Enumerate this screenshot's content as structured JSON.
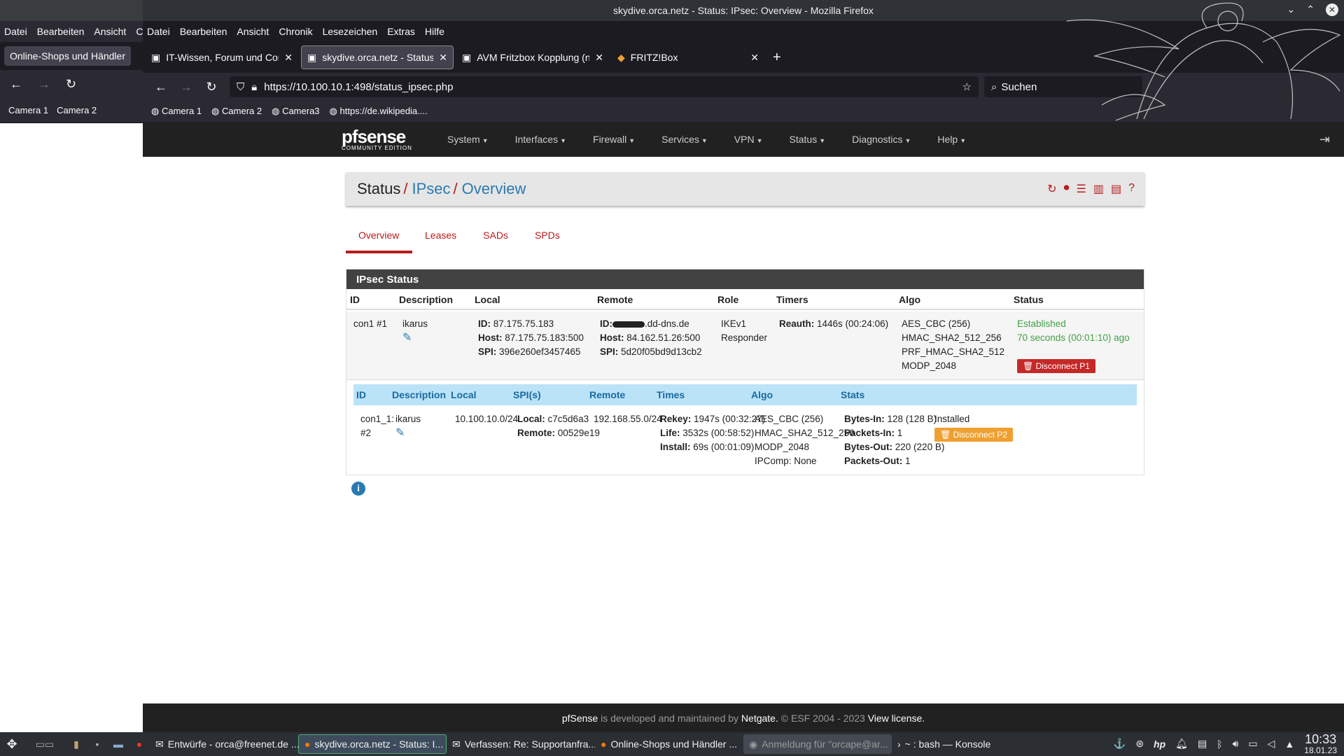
{
  "window_title": "skydive.orca.netz - Status: IPsec: Overview - Mozilla Firefox",
  "menu": [
    "Datei",
    "Bearbeiten",
    "Ansicht",
    "Chronik",
    "Lesezeichen",
    "Extras",
    "Hilfe"
  ],
  "tabs": [
    {
      "label": "IT-Wissen, Forum und Com",
      "active": false
    },
    {
      "label": "skydive.orca.netz - Status:",
      "active": true
    },
    {
      "label": "AVM Fritzbox Kopplung (ne",
      "active": false
    },
    {
      "label": "FRITZ!Box",
      "active": false
    }
  ],
  "new_tab": "+",
  "url": "https://10.100.10.1:498/status_ipsec.php",
  "search_placeholder": "Suchen",
  "bookmarks": [
    "Camera 1",
    "Camera 2",
    "Camera3",
    "https://de.wikipedia...."
  ],
  "bg_window": {
    "menu": [
      "Datei",
      "Bearbeiten",
      "Ansicht",
      "C"
    ],
    "tab": "Online-Shops und Händler",
    "bookmarks": [
      "Camera 1",
      "Camera 2"
    ]
  },
  "pfsense": {
    "logo": "pfsense",
    "logo_sub": "COMMUNITY EDITION",
    "menu": [
      "System",
      "Interfaces",
      "Firewall",
      "Services",
      "VPN",
      "Status",
      "Diagnostics",
      "Help"
    ],
    "breadcrumb": {
      "root": "Status",
      "section": "IPsec",
      "page": "Overview"
    },
    "subtabs": [
      "Overview",
      "Leases",
      "SADs",
      "SPDs"
    ],
    "panel_title": "IPsec Status",
    "p1_headers": [
      "ID",
      "Description",
      "Local",
      "Remote",
      "Role",
      "Timers",
      "Algo",
      "Status"
    ],
    "p1": {
      "id": "con1 #1",
      "description": "ikarus",
      "local_id_label": "ID:",
      "local_id": "87.175.75.183",
      "local_host_label": "Host:",
      "local_host": "87.175.75.183:500",
      "local_spi_label": "SPI:",
      "local_spi": "396e260ef3457465",
      "remote_id_label": "ID:",
      "remote_id": ".dd-dns.de",
      "remote_host_label": "Host:",
      "remote_host": "84.162.51.26:500",
      "remote_spi_label": "SPI:",
      "remote_spi": "5d20f05bd9d13cb2",
      "role1": "IKEv1",
      "role2": "Responder",
      "timer_label": "Reauth:",
      "timer": "1446s (00:24:06)",
      "algo": [
        "AES_CBC (256)",
        "HMAC_SHA2_512_256",
        "PRF_HMAC_SHA2_512",
        "MODP_2048"
      ],
      "status": "Established",
      "status_time": "70 seconds (00:01:10) ago",
      "disconnect": "Disconnect P1"
    },
    "p2_headers": [
      "ID",
      "Description",
      "Local",
      "SPI(s)",
      "Remote",
      "Times",
      "Algo",
      "Stats"
    ],
    "p2": {
      "id1": "con1_1:",
      "id2": "#2",
      "description": "ikarus",
      "local": "10.100.10.0/24",
      "spi_local_label": "Local:",
      "spi_local": "c7c5d6a3",
      "spi_remote_label": "Remote:",
      "spi_remote": "00529e19",
      "remote": "192.168.55.0/24",
      "rekey_label": "Rekey:",
      "rekey": "1947s (00:32:27)",
      "life_label": "Life:",
      "life": "3532s (00:58:52)",
      "install_label": "Install:",
      "install": "69s (00:01:09)",
      "algo": [
        "AES_CBC (256)",
        "HMAC_SHA2_512_256",
        "MODP_2048",
        "IPComp: None"
      ],
      "bytes_in_label": "Bytes-In:",
      "bytes_in": "128 (128 B)",
      "packets_in_label": "Packets-In:",
      "packets_in": "1",
      "bytes_out_label": "Bytes-Out:",
      "bytes_out": "220 (220 B)",
      "packets_out_label": "Packets-Out:",
      "packets_out": "1",
      "state": "Installed",
      "disconnect": "Disconnect P2"
    },
    "footer": {
      "a": "pfSense",
      "b": " is developed and maintained by ",
      "c": "Netgate.",
      "d": " © ESF 2004 - 2023 ",
      "e": "View license."
    }
  },
  "taskbar": [
    {
      "label": "Entwürfe - orca@freenet.de ...",
      "active": false
    },
    {
      "label": "skydive.orca.netz - Status: I...",
      "active": true
    },
    {
      "label": "Verfassen: Re: Supportanfra...",
      "active": false
    },
    {
      "label": "Online-Shops und Händler ...",
      "active": false
    },
    {
      "label": "Anmeldung für \"orcape@ar...",
      "active": false
    },
    {
      "label": "~ : bash — Konsole",
      "active": false
    }
  ],
  "clock": {
    "time": "10:33",
    "date": "18.01.23"
  },
  "colors": {
    "accent": "#b71c1c",
    "link": "#2a7ab0",
    "established": "#43a047",
    "p2head": "#bbe3f8"
  }
}
